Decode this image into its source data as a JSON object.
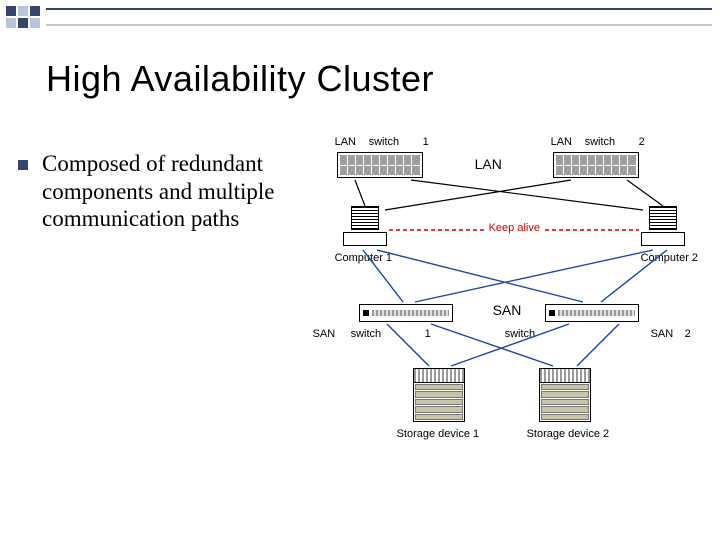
{
  "title": "High Availability Cluster",
  "bullet_text": "Composed of redundant components and multiple communication paths",
  "diagram": {
    "lan_label": "LAN",
    "san_label": "SAN",
    "keep_alive": "Keep alive",
    "switches": {
      "lan1": {
        "brand": "LAN",
        "generic": "switch",
        "num": "1"
      },
      "lan2": {
        "brand": "LAN",
        "generic": "switch",
        "num": "2"
      },
      "san1": {
        "brand": "SAN",
        "generic": "switch",
        "num": "1"
      },
      "san2": {
        "brand": "SAN",
        "generic": "switch",
        "num": "2"
      }
    },
    "computers": {
      "c1": "Computer 1",
      "c2": "Computer 2"
    },
    "storage": {
      "s1": "Storage device 1",
      "s2": "Storage device 2"
    }
  }
}
